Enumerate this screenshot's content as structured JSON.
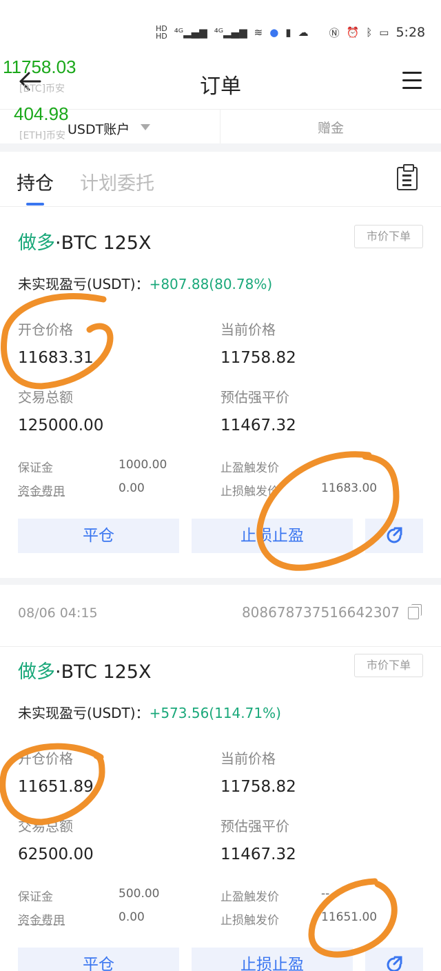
{
  "status_bar": {
    "icons": [
      "hd-icon",
      "signal-icon",
      "signal-icon",
      "wifi-icon",
      "browser-icon",
      "battery-small-icon",
      "wechat-icon",
      "nfc-icon",
      "alarm-icon",
      "bluetooth-icon",
      "battery-icon"
    ],
    "time": "5:28"
  },
  "ticker": {
    "btc_price": "11758.03",
    "btc_label": "[BTC]币安",
    "eth_price": "404.98",
    "eth_label": "[ETH]币安"
  },
  "header": {
    "title": "订单"
  },
  "account": {
    "left_label": "USDT账户",
    "right_label": "赠金"
  },
  "tabs": [
    {
      "label": "持仓",
      "active": true
    },
    {
      "label": "计划委托",
      "active": false
    }
  ],
  "positions": [
    {
      "direction": "做多",
      "symbol": "·BTC 125X",
      "market_button": "市价下单",
      "pnl_label": "未实现盈亏(USDT)：",
      "pnl_value": "+807.88(80.78%)",
      "open_price_label": "开仓价格",
      "open_price": "11683.31",
      "current_price_label": "当前价格",
      "current_price": "11758.82",
      "total_label": "交易总额",
      "total": "125000.00",
      "liq_label": "预估强平价",
      "liq_price": "11467.32",
      "margin_label": "保证金",
      "margin": "1000.00",
      "funding_label": "资金费用",
      "funding": "0.00",
      "tp_label": "止盈触发价",
      "tp_value": "",
      "sl_label": "止损触发价",
      "sl_value": "11683.00",
      "close_button": "平仓",
      "tpsl_button": "止损止盈"
    },
    {
      "direction": "做多",
      "symbol": "·BTC 125X",
      "market_button": "市价下单",
      "pnl_label": "未实现盈亏(USDT)：",
      "pnl_value": "+573.56(114.71%)",
      "open_price_label": "开仓价格",
      "open_price": "11651.89",
      "current_price_label": "当前价格",
      "current_price": "11758.82",
      "total_label": "交易总额",
      "total": "62500.00",
      "liq_label": "预估强平价",
      "liq_price": "11467.32",
      "margin_label": "保证金",
      "margin": "500.00",
      "funding_label": "资金费用",
      "funding": "0.00",
      "tp_label": "止盈触发价",
      "tp_value": "--",
      "sl_label": "止损触发价",
      "sl_value": "11651.00",
      "close_button": "平仓",
      "tpsl_button": "止损止盈"
    }
  ],
  "order_meta": {
    "date": "08/06 04:15",
    "order_id": "808678737516642307"
  },
  "colors": {
    "accent": "#3a76f0",
    "long_green": "#1aa87a",
    "ticker_green": "#1aa81a",
    "annotation_orange": "#f0902a"
  }
}
